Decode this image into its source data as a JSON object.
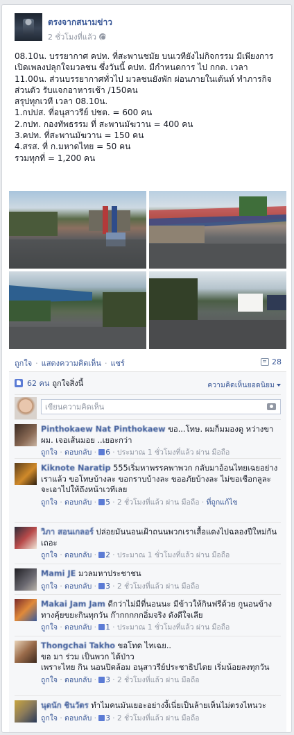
{
  "post": {
    "page_name": "ตรงจากสนามข่าว",
    "time": "2 ชั่วโมงที่แล้ว",
    "text": "08.10น. บรรยากาศ คปท. ที่สะพานชมัย บนเวทียังไม่กิจกรรม มีเพียงการเปิดเพลงปลุกใจมวลชน ซึ่งวันนี้ คปท. มีกำหนดการ ไป กกต. เวลา 11.00น. ส่วนบรรยากาศทั่วไป มวลชนยังพัก ผ่อนภายในเต้นท์ ทำภารกิจส่วนตัว รับแจกอาหารเช้า /150คน\nสรุปทุกเวที เวลา 08.10น.\n1.กปปส. ที่อนุสาวรีย์ ปชต. = 600 คน\n2.กปท. กองทัพธรรม ที่ สะพานมัฆวาน = 400 คน\n3.คปท. ที่สะพานมัฆวาน = 150 คน\n4.สรส. ที่ ก.มหาดไทย = 50 คน\nรวมทุกที่ = 1,200 คน"
  },
  "actions": {
    "like": "ถูกใจ",
    "comment": "แสดงความคิดเห็น",
    "share": "แชร์",
    "comment_count": "28"
  },
  "likes": {
    "count": "62 คน",
    "text": "ถูกใจสิ่งนี้",
    "sort_option": "ความคิดเห็นยอดนิยม"
  },
  "write_comment": {
    "placeholder": "เขียนความคิดเห็น"
  },
  "comments": [
    {
      "author": "Pinthokaew Nat Pinthokaew",
      "text": "ขอ...โทษ. ผมก็มมองดู หว่างขาผม. เจอเส้นมอย ..เยอะกว่า",
      "reply": "ตอบกลับ",
      "likes": "6",
      "time": "ประมาณ 1 ชั่วโมงที่แล้ว ผ่าน มือถือ"
    },
    {
      "author": "Kiknote Naratip",
      "text": "555เริ่มหาพรรคพาพวก กลับมาอ้อนไทยเฉยอย่างเราแล้ว ขอโทษบ้างละ ขอกราบบ้างละ ขออภัยบ้างละ ไม่ขอเชือกลูละ จะเอาไปให้ถึงหน้าเวทีเลย",
      "reply": "ตอบกลับ",
      "likes": "5",
      "time": "2 ชั่วโมงที่แล้ว ผ่าน มือถือ",
      "extra": "ที่ถูกแก้ไข"
    },
    {
      "author": "วิภา สอนเกลอร์",
      "text": "ปล่อยมันนอนเฝ้าถนนพวกเราเสื้อแดงไปฉลองปีใหม่กันเถอะ",
      "reply": "ตอบกลับ",
      "likes": "2",
      "time": "ประมาณ 1 ชั่วโมงที่แล้ว ผ่าน มือถือ"
    },
    {
      "author": "Mami JE",
      "text": "มวลมหาประชาชน",
      "reply": "ตอบกลับ",
      "likes": "3",
      "time": "2 ชั่วโมงที่แล้ว ผ่าน มือถือ"
    },
    {
      "author": "Makai Jam Jam",
      "text": "ดีกว่าไม่มีที่นอนนะ มีข้าวให้กินฟรีด้วย กูนอนข้างทางคุ้ยขยะกินทุกวัน ก๊ากกกกกอิ่มจริง ดังดีใจเลีย",
      "reply": "ตอบกลับ",
      "likes": "1",
      "time": "ประมาณ 1 ชั่วโมงที่แล้ว ผ่าน มือถือ"
    },
    {
      "author": "Thongchai Takho",
      "text": "ขอโทด ไทเฉย..\nขอ มา ร่วม เป็นพวก ได้ป่าว\nเพราะไทย กิน นอนปิดล้อม อนุสาวรีย์ประชาธิปไตย เริ่มน้อยลงทุกวัน",
      "reply": "ตอบกลับ",
      "likes": "3",
      "time": "2 ชั่วโมงที่แล้ว ผ่าน มือถือ"
    },
    {
      "author": "นุดนัก ชินวัตร",
      "text": "ทำไมคนมันเยอะอย่างงี้เนี่ยเป็นล้ายเห็นไม่ตรงไหนวะ",
      "reply": "ตอบกลับ",
      "likes": "3",
      "time": "2 ชั่วโมงที่แล้ว ผ่าน มือถือ"
    }
  ],
  "labels": {
    "like": "ถูกใจ"
  }
}
